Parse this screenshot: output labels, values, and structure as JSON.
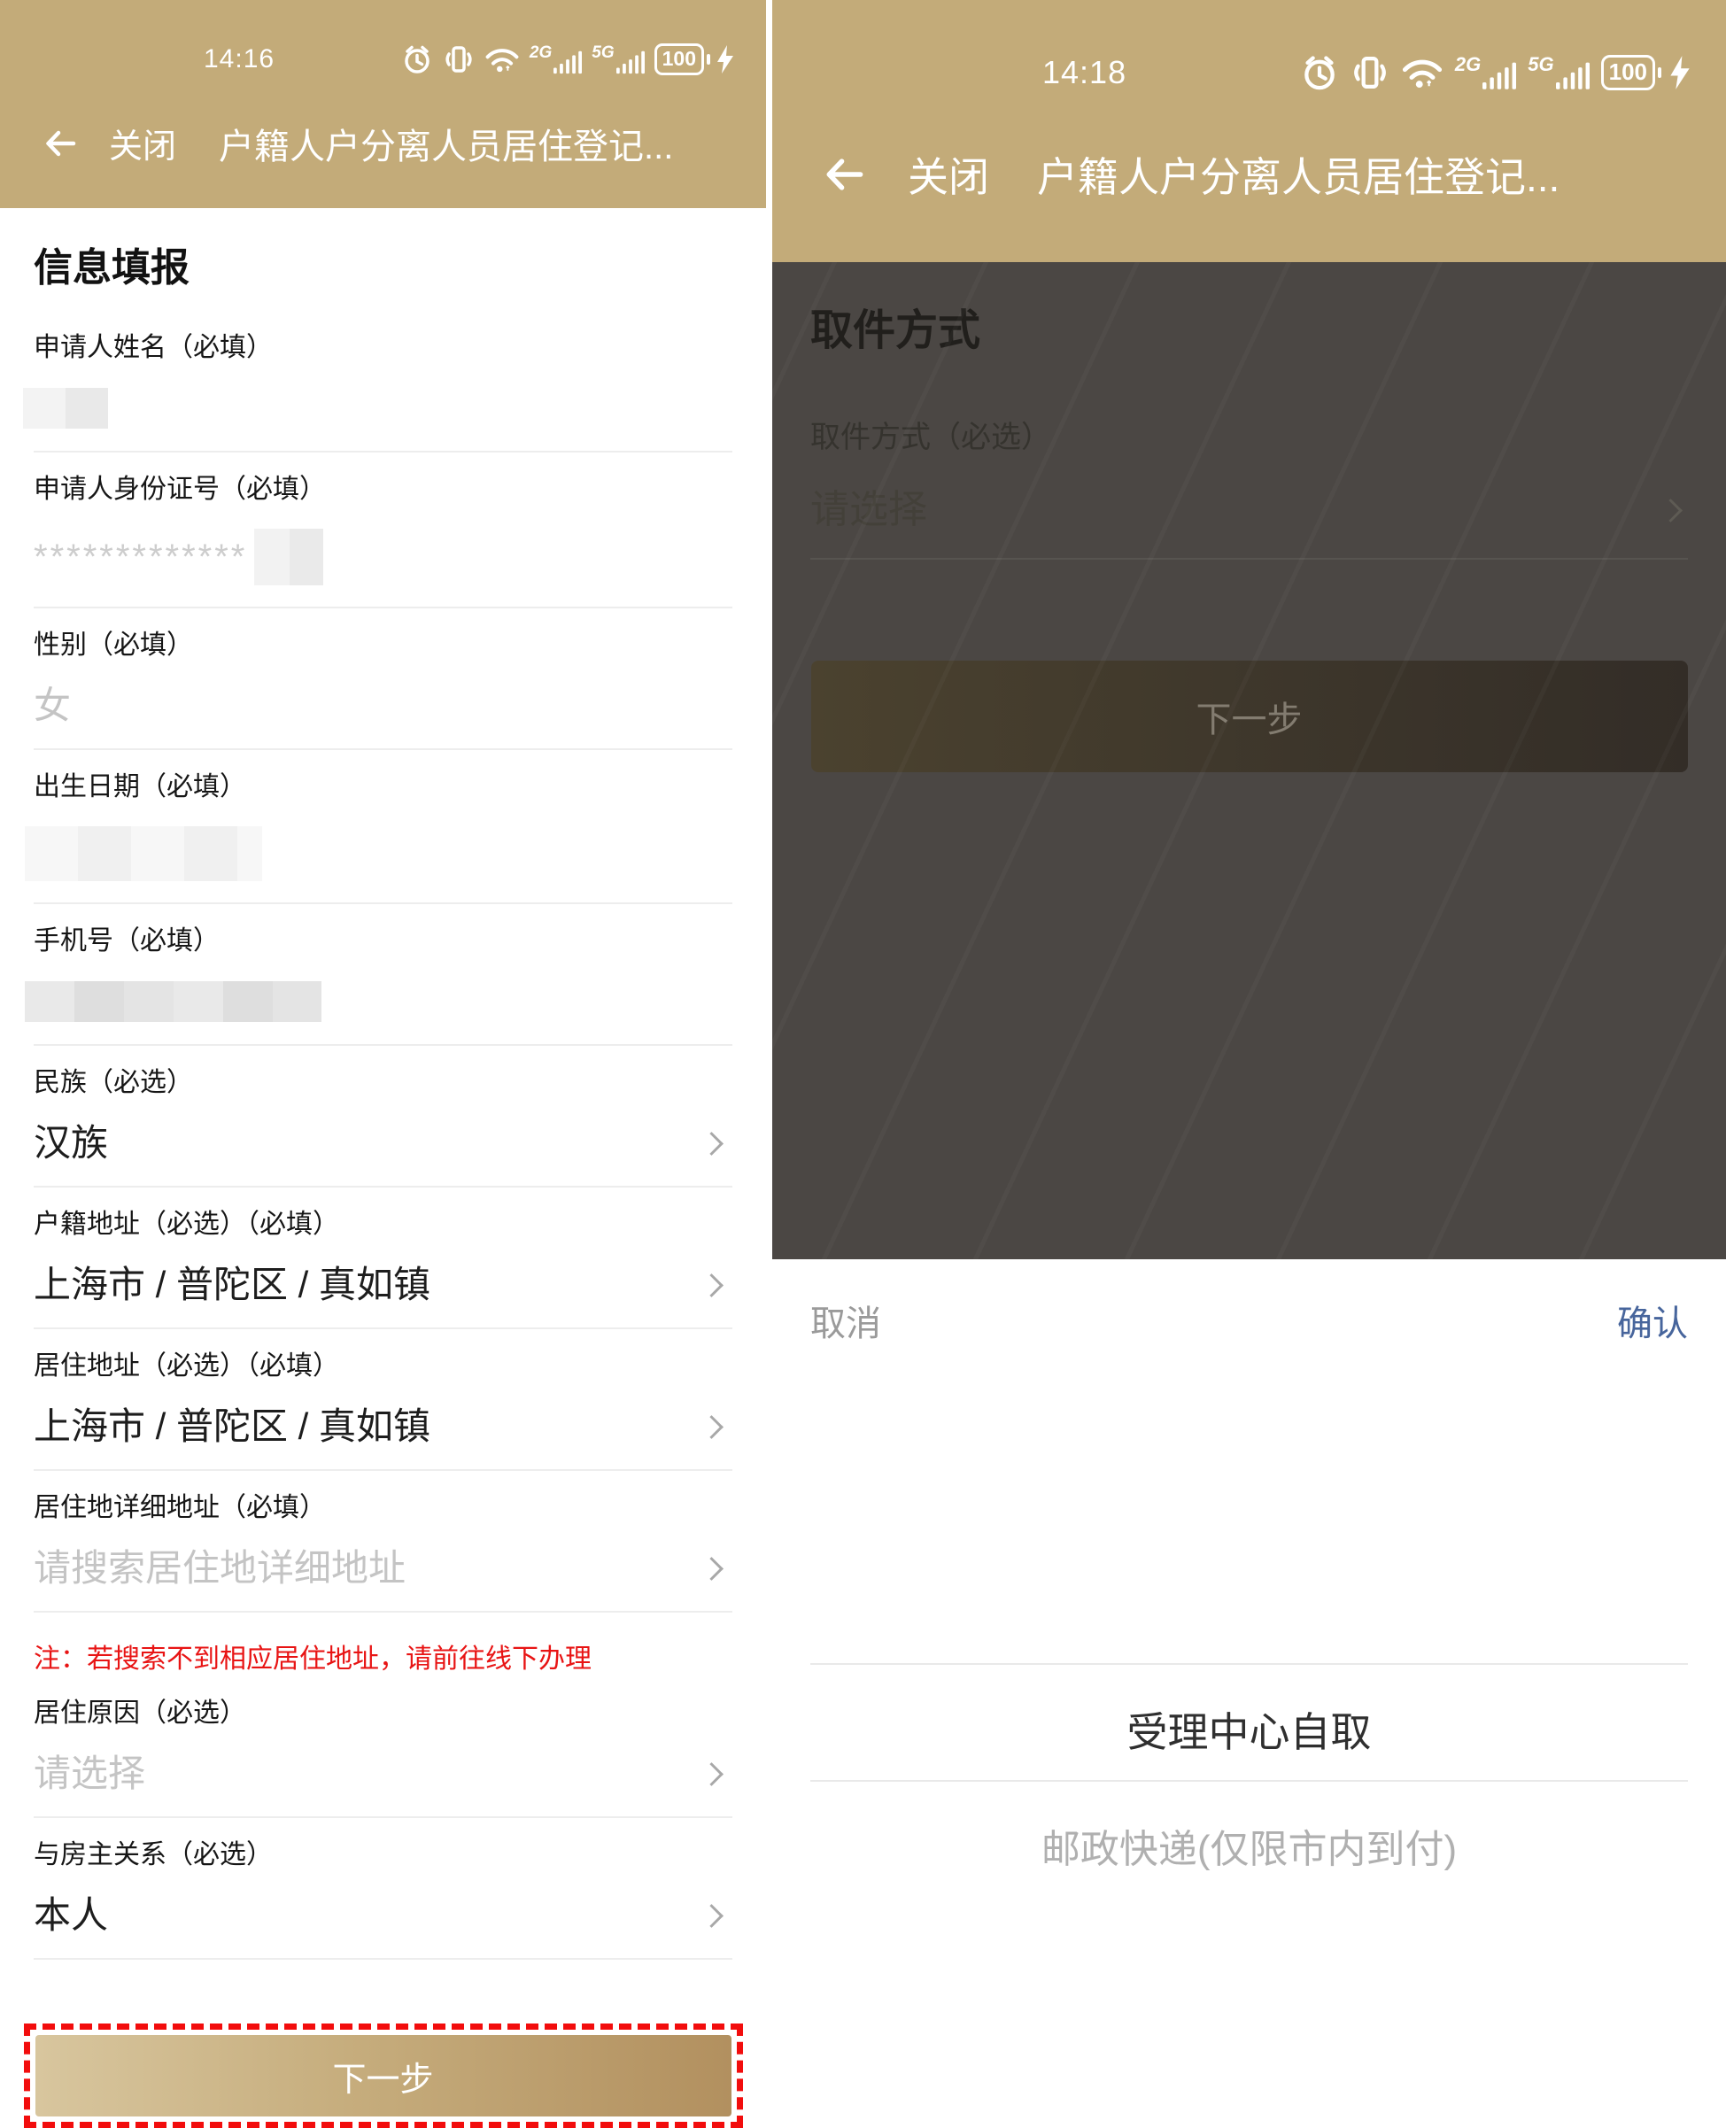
{
  "colors": {
    "gold_header": "#c3ab79",
    "accent_red": "#e81414",
    "highlight_dashed_red": "#f20d0d",
    "confirm_blue": "#47659c",
    "button_gradient_start": "#d8c69e",
    "button_gradient_end": "#b2905f",
    "dim_overlay_bg": "#4b4744"
  },
  "left": {
    "status": {
      "time": "14:16",
      "net_2g": "2G",
      "net_5g": "5G",
      "battery": "100"
    },
    "nav": {
      "close": "关闭",
      "title": "户籍人户分离人员居住登记..."
    },
    "section_title": "信息填报",
    "fields": {
      "name": {
        "label": "申请人姓名（必填）",
        "value_redacted": true
      },
      "id_number": {
        "label": "申请人身份证号（必填）",
        "masked": "*************"
      },
      "gender": {
        "label": "性别（必填）",
        "value": "女"
      },
      "birth_date": {
        "label": "出生日期（必填）",
        "value_redacted": true
      },
      "phone": {
        "label": "手机号（必填）",
        "value_redacted": true
      },
      "ethnicity": {
        "label": "民族（必选）",
        "value": "汉族"
      },
      "household_address": {
        "label": "户籍地址（必选）（必填）",
        "value": "上海市 / 普陀区 / 真如镇"
      },
      "residence_address": {
        "label": "居住地址（必选）（必填）",
        "value": "上海市 / 普陀区 / 真如镇"
      },
      "residence_detail": {
        "label": "居住地详细地址（必填）",
        "placeholder": "请搜索居住地详细地址"
      },
      "residence_reason": {
        "label": "居住原因（必选）",
        "placeholder": "请选择"
      },
      "owner_relation": {
        "label": "与房主关系（必选）",
        "value": "本人"
      }
    },
    "note": "注：若搜索不到相应居住地址，请前往线下办理",
    "next_button": "下一步"
  },
  "right": {
    "status": {
      "time": "14:18",
      "net_2g": "2G",
      "net_5g": "5G",
      "battery": "100"
    },
    "nav": {
      "close": "关闭",
      "title": "户籍人户分离人员居住登记..."
    },
    "section_title": "取件方式",
    "field": {
      "label": "取件方式（必选）",
      "placeholder": "请选择"
    },
    "next_button": "下一步",
    "picker": {
      "cancel": "取消",
      "confirm": "确认",
      "option_selected": "受理中心自取",
      "option_unselected": "邮政快递(仅限市内到付)"
    }
  }
}
